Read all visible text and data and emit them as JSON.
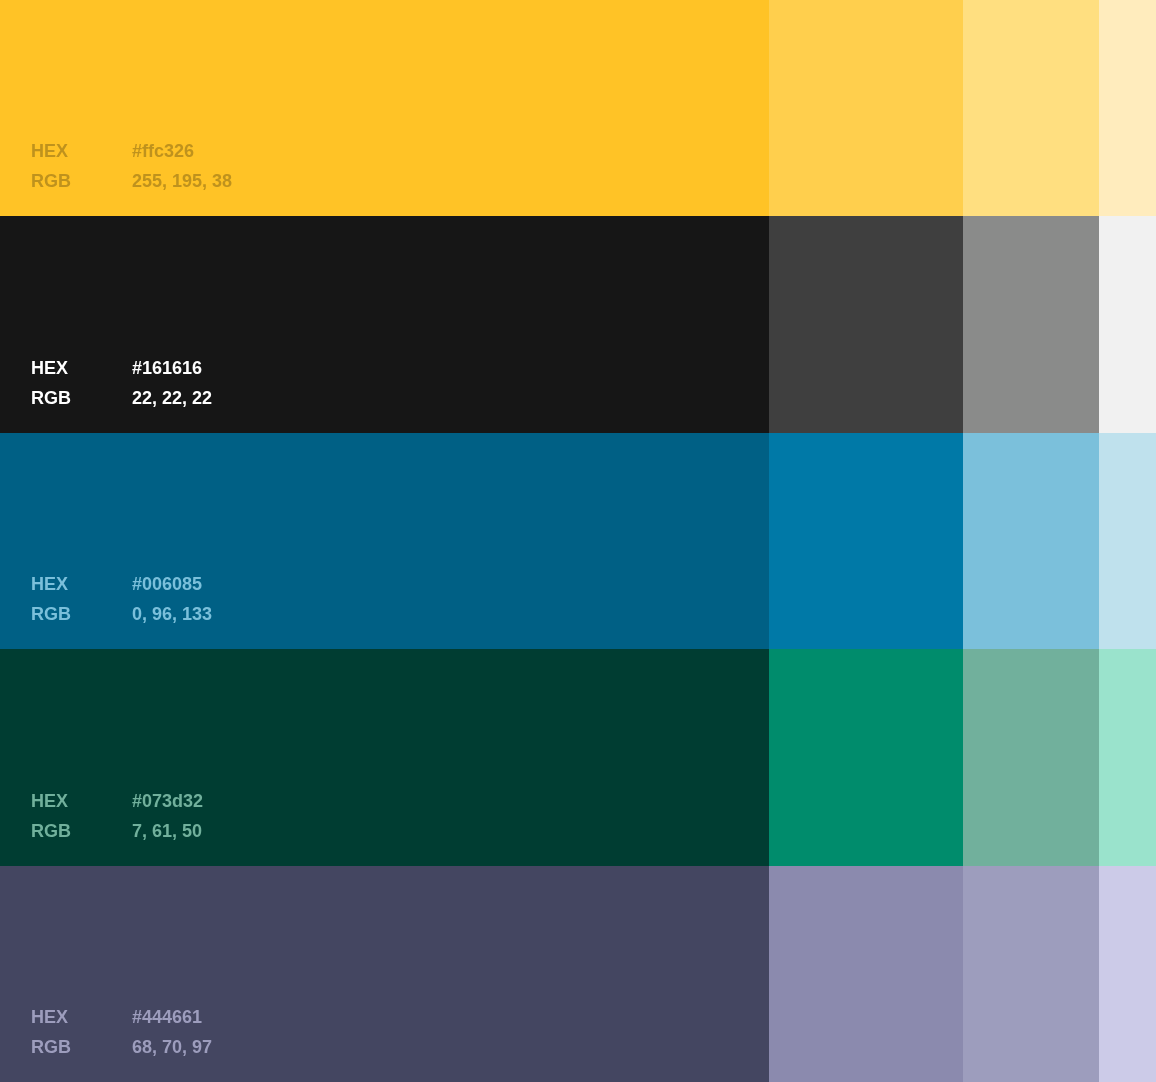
{
  "swatches": [
    {
      "kind": "light",
      "color": "#ffc326",
      "hex_label": "HEX",
      "hex": "#ffc326",
      "rgb_label": "RGB",
      "rgb": "255, 195, 38",
      "tints": [
        {
          "color": "#ffcf4d"
        },
        {
          "color": "#ffdf80"
        },
        {
          "color": "#ffecbd"
        }
      ]
    },
    {
      "kind": "neutral",
      "color": "#161616",
      "hex_label": "HEX",
      "hex": "#161616",
      "rgb_label": "RGB",
      "rgb": "22, 22, 22",
      "tints": [
        {
          "color": "#3f3f3f"
        },
        {
          "color": "#8a8b8a"
        },
        {
          "color": "#f1f1f1"
        }
      ]
    },
    {
      "kind": "tinted",
      "color": "#006085",
      "hex_label": "HEX",
      "hex": "#006085",
      "rgb_label": "RGB",
      "rgb": "0, 96, 133",
      "tints": [
        {
          "color": "#0079a7"
        },
        {
          "color": "#7bc0db"
        },
        {
          "color": "#bfe1ed"
        }
      ]
    },
    {
      "kind": "tinted",
      "color": "#003d32",
      "hex_label": "HEX",
      "hex": "#073d32",
      "rgb_label": "RGB",
      "rgb": "7, 61, 50",
      "tints": [
        {
          "color": "#008c6c"
        },
        {
          "color": "#71b09c"
        },
        {
          "color": "#9ae3cc"
        }
      ]
    },
    {
      "kind": "tinted",
      "color": "#444661",
      "hex_label": "HEX",
      "hex": "#444661",
      "rgb_label": "RGB",
      "rgb": "68, 70, 97",
      "tints": [
        {
          "color": "#8b8aae"
        },
        {
          "color": "#9d9dbd"
        },
        {
          "color": "#cccbe8"
        }
      ]
    }
  ]
}
